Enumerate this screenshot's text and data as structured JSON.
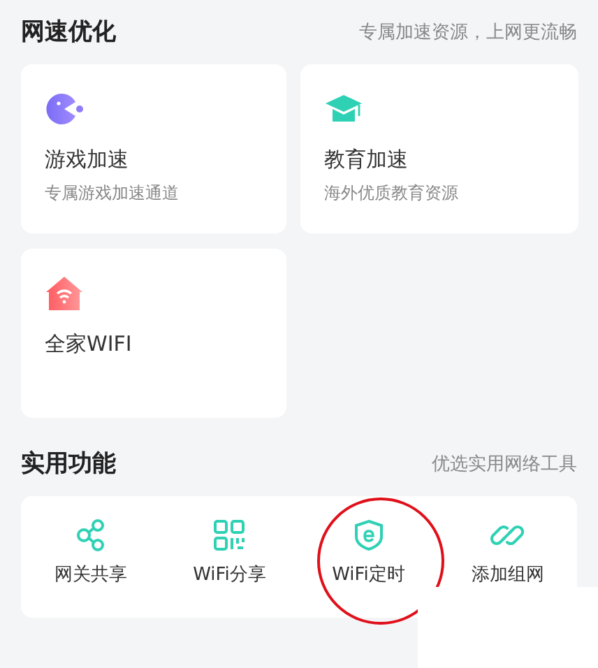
{
  "sections": [
    {
      "kind": "cards",
      "title": "网速优化",
      "subtitle": "专属加速资源，上网更流畅",
      "items": [
        {
          "kind": "game",
          "title": "游戏加速",
          "desc": "专属游戏加速通道"
        },
        {
          "kind": "education",
          "title": "教育加速",
          "desc": "海外优质教育资源"
        },
        {
          "kind": "home-wifi",
          "title": "全家WIFI"
        }
      ]
    },
    {
      "kind": "tools",
      "title": "实用功能",
      "subtitle": "优选实用网络工具",
      "items": [
        {
          "kind": "share",
          "label": "网关共享",
          "highlighted": false
        },
        {
          "kind": "qr",
          "label": "WiFi分享",
          "highlighted": false
        },
        {
          "kind": "shield",
          "label": "WiFi定时",
          "highlighted": true
        },
        {
          "kind": "link",
          "label": "添加组网",
          "highlighted": false
        }
      ]
    }
  ]
}
